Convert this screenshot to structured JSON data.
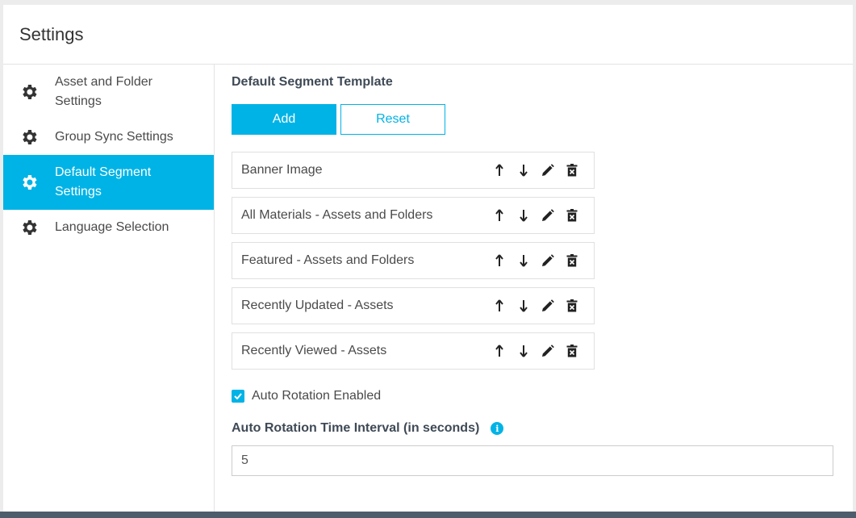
{
  "header": {
    "title": "Settings"
  },
  "sidebar": {
    "items": [
      {
        "label": "Asset and Folder Settings",
        "icon": "gear-icon",
        "active": false
      },
      {
        "label": "Group Sync Settings",
        "icon": "gear-icon",
        "active": false
      },
      {
        "label": "Default Segment Settings",
        "icon": "gear-icon",
        "active": true
      },
      {
        "label": "Language Selection",
        "icon": "gear-icon",
        "active": false
      }
    ]
  },
  "main": {
    "section_title": "Default Segment Template",
    "add_label": "Add",
    "reset_label": "Reset",
    "segments": [
      {
        "label": "Banner Image"
      },
      {
        "label": "All Materials - Assets and Folders"
      },
      {
        "label": "Featured - Assets and Folders"
      },
      {
        "label": "Recently Updated - Assets"
      },
      {
        "label": "Recently Viewed - Assets"
      }
    ],
    "auto_rotation_label": "Auto Rotation Enabled",
    "auto_rotation_checked": true,
    "interval_label": "Auto Rotation Time Interval (in seconds)",
    "interval_value": "5"
  },
  "colors": {
    "accent": "#00b3e6",
    "footer": "#4e5d6c"
  }
}
